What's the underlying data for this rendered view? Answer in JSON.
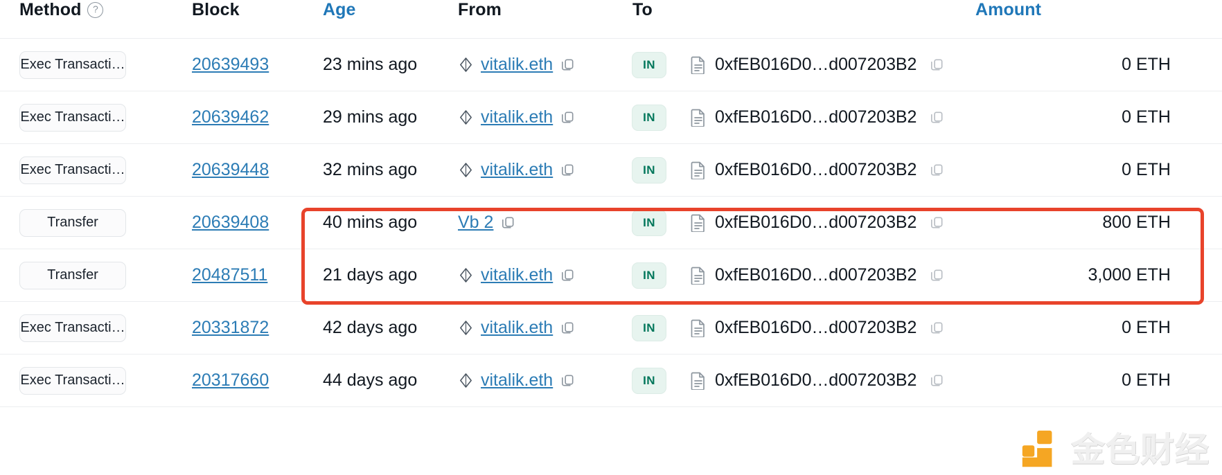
{
  "table": {
    "columns": [
      {
        "key": "method",
        "label": "Method",
        "style": "plain",
        "help_icon": "?"
      },
      {
        "key": "block",
        "label": "Block",
        "style": "plain"
      },
      {
        "key": "age",
        "label": "Age",
        "style": "link"
      },
      {
        "key": "from",
        "label": "From",
        "style": "plain"
      },
      {
        "key": "to",
        "label": "To",
        "style": "plain"
      },
      {
        "key": "amount",
        "label": "Amount",
        "style": "link"
      }
    ],
    "rows": [
      {
        "method": "Exec Transacti…",
        "block": "20639493",
        "age": "23 mins ago",
        "from": "vitalik.eth",
        "from_has_eth_icon": true,
        "direction": "IN",
        "to": "0xfEB016D0…d007203B2",
        "amount": "0 ETH",
        "highlighted": false
      },
      {
        "method": "Exec Transacti…",
        "block": "20639462",
        "age": "29 mins ago",
        "from": "vitalik.eth",
        "from_has_eth_icon": true,
        "direction": "IN",
        "to": "0xfEB016D0…d007203B2",
        "amount": "0 ETH",
        "highlighted": false
      },
      {
        "method": "Exec Transacti…",
        "block": "20639448",
        "age": "32 mins ago",
        "from": "vitalik.eth",
        "from_has_eth_icon": true,
        "direction": "IN",
        "to": "0xfEB016D0…d007203B2",
        "amount": "0 ETH",
        "highlighted": false
      },
      {
        "method": "Transfer",
        "block": "20639408",
        "age": "40 mins ago",
        "from": "Vb 2",
        "from_has_eth_icon": false,
        "direction": "IN",
        "to": "0xfEB016D0…d007203B2",
        "amount": "800 ETH",
        "highlighted": true
      },
      {
        "method": "Transfer",
        "block": "20487511",
        "age": "21 days ago",
        "from": "vitalik.eth",
        "from_has_eth_icon": true,
        "direction": "IN",
        "to": "0xfEB016D0…d007203B2",
        "amount": "3,000 ETH",
        "highlighted": true
      },
      {
        "method": "Exec Transacti…",
        "block": "20331872",
        "age": "42 days ago",
        "from": "vitalik.eth",
        "from_has_eth_icon": true,
        "direction": "IN",
        "to": "0xfEB016D0…d007203B2",
        "amount": "0 ETH",
        "highlighted": false
      },
      {
        "method": "Exec Transacti…",
        "block": "20317660",
        "age": "44 days ago",
        "from": "vitalik.eth",
        "from_has_eth_icon": true,
        "direction": "IN",
        "to": "0xfEB016D0…d007203B2",
        "amount": "0 ETH",
        "highlighted": false
      }
    ]
  },
  "icons": {
    "eth": "ethereum-diamond-icon",
    "copy": "copy-icon",
    "contract": "contract-document-icon",
    "help": "help-circle-icon"
  },
  "annotation": {
    "name": "red-highlight-box",
    "color": "#e8432b"
  },
  "watermark": {
    "text": "金色财经",
    "mark_color": "#f5a623"
  },
  "colors": {
    "link": "#2c7cb5",
    "header_link": "#1f77b8",
    "text": "#111820",
    "badge_in_bg": "#e7f4ef",
    "badge_in_text": "#00765a",
    "pill_bg": "#fbfbfc",
    "row_border": "#eceef0"
  }
}
